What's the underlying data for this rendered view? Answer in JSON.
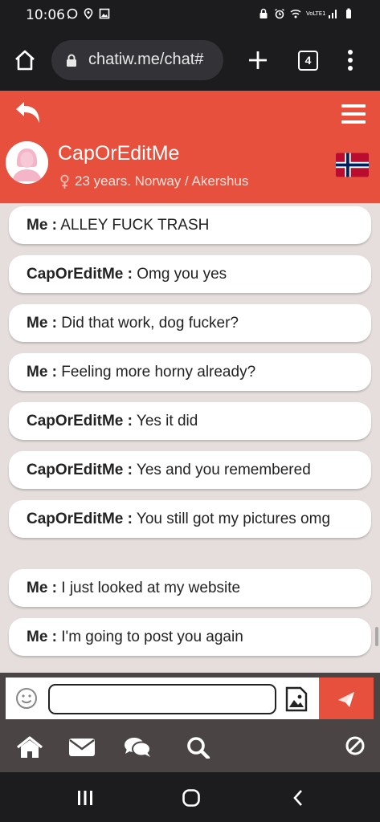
{
  "status_bar": {
    "time": "10:06",
    "left_icons": [
      "whatsapp-icon",
      "location-icon",
      "gallery-icon"
    ],
    "right_icons": [
      "lock-icon",
      "alarm-icon",
      "wifi-icon",
      "volte-icon",
      "signal-icon",
      "battery-icon"
    ],
    "volte_text": "VoLTE1"
  },
  "browser": {
    "url": "chatiw.me/chat#",
    "tab_count": "4"
  },
  "header": {
    "profile_name": "CapOrEditMe",
    "profile_info": "23 years. Norway / Akershus",
    "gender_icon": "female-icon",
    "flag": "norway-flag",
    "accent_color": "#e8503e"
  },
  "messages": [
    {
      "sender": "Me :",
      "text": "ALLEY FUCK TRASH"
    },
    {
      "sender": "CapOrEditMe :",
      "text": "Omg you yes"
    },
    {
      "sender": "Me :",
      "text": "Did that work, dog fucker?"
    },
    {
      "sender": "Me :",
      "text": "Feeling more horny already?"
    },
    {
      "sender": "CapOrEditMe :",
      "text": "Yes it did"
    },
    {
      "sender": "CapOrEditMe :",
      "text": "Yes and you remembered"
    },
    {
      "sender": "CapOrEditMe :",
      "text": "You still got my pictures omg"
    },
    {
      "sender": "Me :",
      "text": "I just looked at my website"
    },
    {
      "sender": "Me :",
      "text": "I'm going to post you again"
    }
  ],
  "input": {
    "value": "",
    "placeholder": ""
  },
  "bottom_nav": [
    "home-icon",
    "mail-icon",
    "chat-icon",
    "search-icon",
    "block-icon"
  ],
  "android_nav": [
    "recents-icon",
    "home-icon",
    "back-icon"
  ]
}
